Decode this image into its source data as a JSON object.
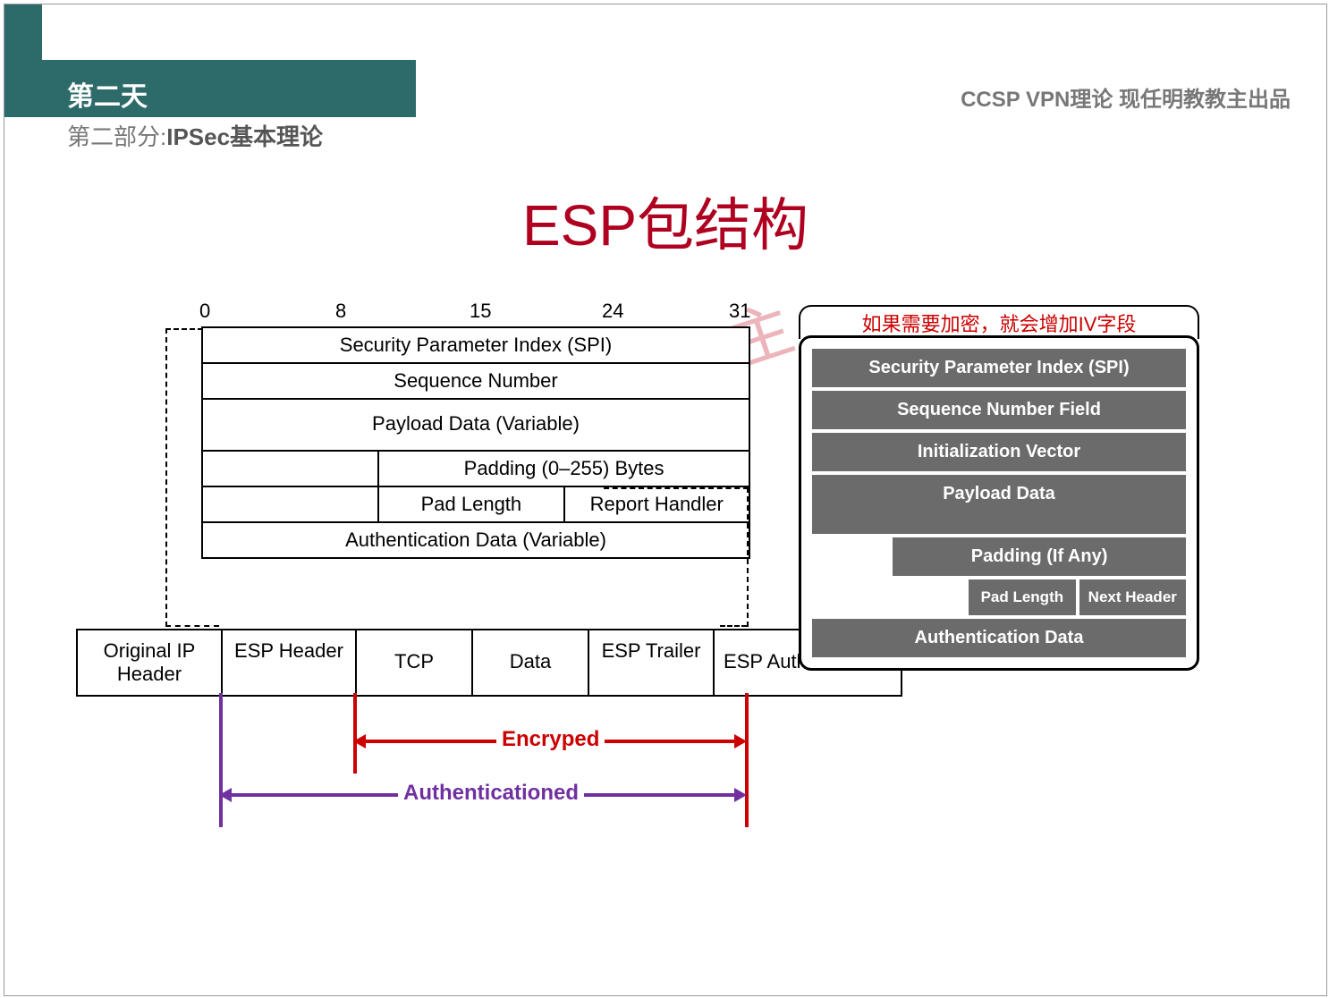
{
  "header": {
    "day": "第二天",
    "subtitle_prefix": "第二部分:",
    "subtitle_bold": "IPSec基本理论",
    "top_right": "CCSP VPN理论 现任明教教主出品"
  },
  "title": "ESP包结构",
  "ruler": {
    "b0": "0",
    "b8": "8",
    "b15": "15",
    "b24": "24",
    "b31": "31"
  },
  "esp": {
    "spi": "Security Parameter Index (SPI)",
    "seq": "Sequence Number",
    "payload": "Payload Data (Variable)",
    "padding": "Padding (0–255) Bytes",
    "padlen": "Pad Length",
    "report": "Report Handler",
    "auth": "Authentication Data (Variable)"
  },
  "packet": {
    "orig": "Original IP Header",
    "esph": "ESP Header",
    "tcp": "TCP",
    "data": "Data",
    "trailer": "ESP Trailer",
    "espauth": "ESP Authentication"
  },
  "arrows": {
    "enc": "Encryped",
    "auth": "Authenticationed"
  },
  "iv_note": "如果需要加密，就会增加IV字段",
  "grey": {
    "spi": "Security Parameter Index (SPI)",
    "seq": "Sequence Number Field",
    "iv": "Initialization Vector",
    "payload": "Payload Data",
    "padding": "Padding (If Any)",
    "padlen": "Pad Length",
    "next": "Next Header",
    "auth": "Authentication Data"
  },
  "watermark": "现任明教教主"
}
